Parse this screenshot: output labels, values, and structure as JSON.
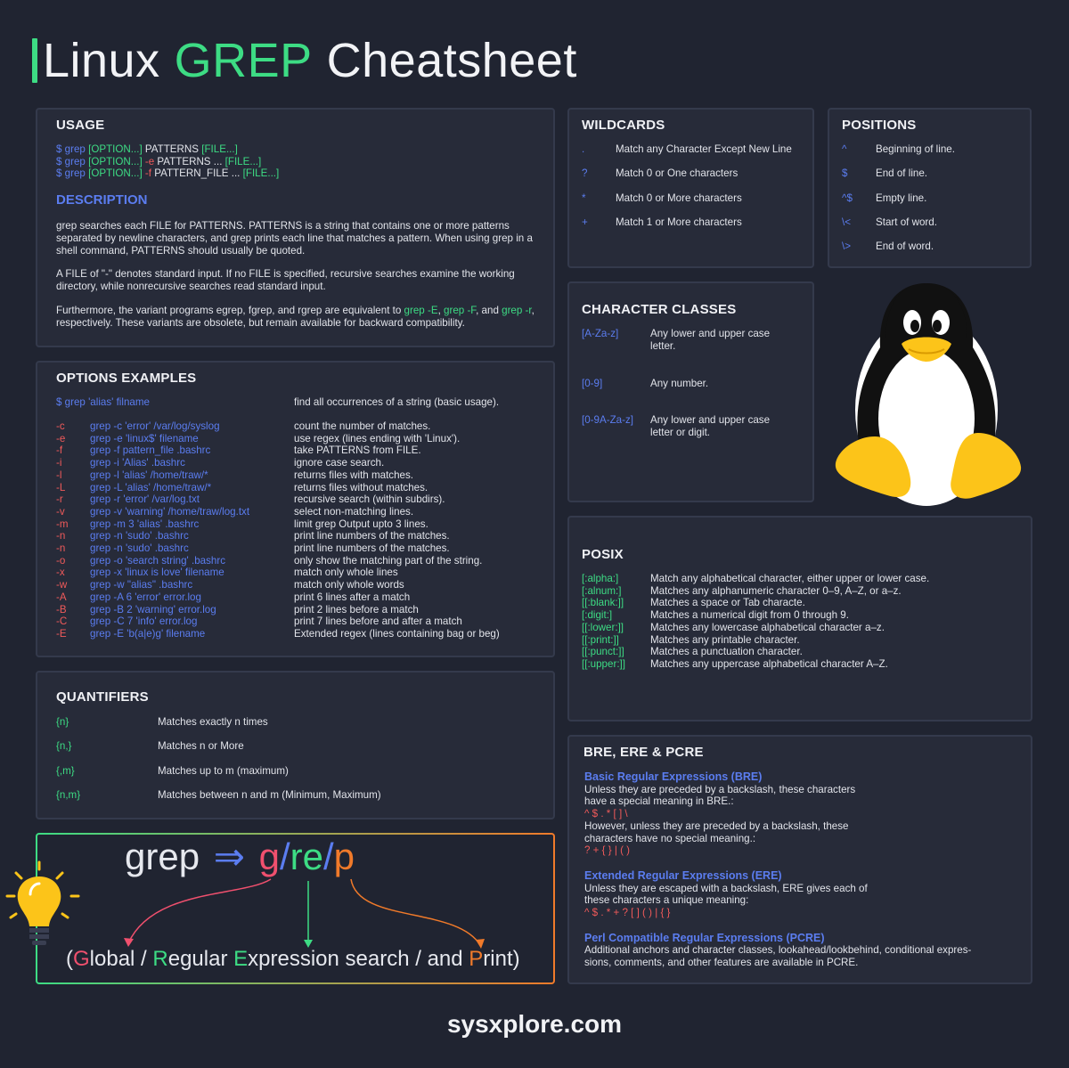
{
  "title": {
    "prefix": "Linux",
    "highlight": "GREP",
    "suffix": "Cheatsheet"
  },
  "usage": {
    "heading": "USAGE",
    "lines": [
      {
        "cmd": "$ grep",
        "opt": "[OPTION...]",
        "flag": "",
        "rest": " PATTERNS ",
        "file": "[FILE...]"
      },
      {
        "cmd": "$ grep",
        "opt": "[OPTION...]",
        "flag": " -e",
        "rest": " PATTERNS ... ",
        "file": "[FILE...]"
      },
      {
        "cmd": "$ grep",
        "opt": "[OPTION...]",
        "flag": " -f",
        "rest": " PATTERN_FILE ... ",
        "file": "[FILE...]"
      }
    ],
    "description_heading": "DESCRIPTION",
    "p1": "grep searches each FILE for PATTERNS. PATTERNS is a string that contains one or more patterns separated by newline characters, and grep prints each line that matches a pattern. When using grep in a shell command, PATTERNS should usually be quoted.",
    "p2": "A FILE of \"-\" denotes standard input. If no FILE is specified, recursive searches examine the working directory, while nonrecursive searches read standard input.",
    "p3a": "Furthermore, the variant programs egrep, fgrep, and rgrep are equivalent to ",
    "p3b": "grep -E",
    "p3c": ", ",
    "p3d": "grep -F",
    "p3e": ", and ",
    "p3f": "grep -r",
    "p3g": ", respectively. These variants are obsolete, but remain available for backward compatibility."
  },
  "options": {
    "heading": "OPTIONS EXAMPLES",
    "basic_cmd": "$ grep 'alias' filname",
    "basic_desc": "find all occurrences of a string (basic usage).",
    "rows": [
      {
        "flag": "-c",
        "cmd": "grep -c 'error' /var/log/syslog",
        "desc": "count the number of matches."
      },
      {
        "flag": "-e",
        "cmd": "grep -e 'linux$' filename",
        "desc": "use regex (lines ending with 'Linux')."
      },
      {
        "flag": "-f",
        "cmd": "grep -f pattern_file .bashrc",
        "desc": "take PATTERNS from FILE."
      },
      {
        "flag": "-i",
        "cmd": "grep -i 'Alias' .bashrc",
        "desc": "ignore case search."
      },
      {
        "flag": "-l",
        "cmd": "grep -l 'alias' /home/traw/*",
        "desc": "returns files with matches."
      },
      {
        "flag": "-L",
        "cmd": "grep -L 'alias' /home/traw/*",
        "desc": "returns files without matches."
      },
      {
        "flag": "-r",
        "cmd": "grep -r 'error' /var/log.txt",
        "desc": "recursive search (within subdirs)."
      },
      {
        "flag": "-v",
        "cmd": "grep -v 'warning' /home/traw/log.txt",
        "desc": "select non-matching lines."
      },
      {
        "flag": "-m",
        "cmd": "grep -m 3 'alias' .bashrc",
        "desc": "limit grep Output upto 3 lines."
      },
      {
        "flag": "-n",
        "cmd": "grep -n 'sudo' .bashrc",
        "desc": "print line numbers of the matches."
      },
      {
        "flag": "-n",
        "cmd": "grep -n 'sudo' .bashrc",
        "desc": "print line numbers of the matches."
      },
      {
        "flag": "-o",
        "cmd": "grep -o 'search string' .bashrc",
        "desc": "only show the matching part of the string."
      },
      {
        "flag": "-x",
        "cmd": "grep -x 'linux is love' filename",
        "desc": "match only whole lines"
      },
      {
        "flag": "-w",
        "cmd": "grep -w \"alias\" .bashrc",
        "desc": "match only whole words"
      },
      {
        "flag": "-A",
        "cmd": "grep -A 6 'error' error.log",
        "desc": "print 6 lines after a match"
      },
      {
        "flag": "-B",
        "cmd": "grep -B 2 'warning' error.log",
        "desc": "print 2 lines before a match"
      },
      {
        "flag": "-C",
        "cmd": "grep -C 7 'info' error.log",
        "desc": "print 7 lines before and after a match"
      },
      {
        "flag": "-E",
        "cmd": "grep -E 'b(a|e)g' filename",
        "desc": "Extended regex (lines containing bag or beg)"
      }
    ]
  },
  "quantifiers": {
    "heading": "QUANTIFIERS",
    "rows": [
      {
        "sym": "{n}",
        "desc": "Matches exactly n times"
      },
      {
        "sym": "{n,}",
        "desc": "Matches n or More"
      },
      {
        "sym": "{,m}",
        "desc": "Matches up to m (maximum)"
      },
      {
        "sym": "{n,m}",
        "desc": "Matches between n and m (Minimum, Maximum)"
      }
    ]
  },
  "wildcards": {
    "heading": "WILDCARDS",
    "rows": [
      {
        "sym": ".",
        "desc": "Match any Character Except New Line"
      },
      {
        "sym": "?",
        "desc": "Match 0 or One characters"
      },
      {
        "sym": "*",
        "desc": "Match 0 or More characters"
      },
      {
        "sym": "+",
        "desc": "Match 1 or More characters"
      }
    ]
  },
  "positions": {
    "heading": "POSITIONS",
    "rows": [
      {
        "sym": "^",
        "desc": "Beginning of line."
      },
      {
        "sym": "$",
        "desc": "End of line."
      },
      {
        "sym": "^$",
        "desc": "Empty line."
      },
      {
        "sym": "\\<",
        "desc": "Start of word."
      },
      {
        "sym": "\\>",
        "desc": "End of word."
      }
    ]
  },
  "char_classes": {
    "heading": "CHARACTER CLASSES",
    "rows": [
      {
        "sym": "[A-Za-z]",
        "desc1": "Any lower and upper case",
        "desc2": " letter."
      },
      {
        "sym": "[0-9]",
        "desc1": "Any number.",
        "desc2": ""
      },
      {
        "sym": "[0-9A-Za-z]",
        "desc1": "Any lower and upper case",
        "desc2": "letter or digit."
      }
    ]
  },
  "posix": {
    "heading": "POSIX",
    "rows": [
      {
        "sym": "[:alpha:]",
        "desc": "Match any alphabetical character, either upper or lower case."
      },
      {
        "sym": "[:alnum:]",
        "desc": "Matches any alphanumeric character 0–9, A–Z, or a–z."
      },
      {
        "sym": "[[:blank:]]",
        "desc": "Matches a space or Tab characte."
      },
      {
        "sym": "[:digit:]",
        "desc": "Matches a numerical digit from 0 through 9."
      },
      {
        "sym": "[[:lower:]]",
        "desc": "Matches any lowercase alphabetical character a–z."
      },
      {
        "sym": "[[:print:]]",
        "desc": "Matches any printable character."
      },
      {
        "sym": "[[:punct:]]",
        "desc": "Matches a punctuation character."
      },
      {
        "sym": "[[:upper:]]",
        "desc": "Matches any uppercase alphabetical character A–Z."
      }
    ]
  },
  "regex": {
    "heading": "BRE, ERE & PCRE",
    "bre_title": "Basic Regular Expressions (BRE)",
    "bre_l1": "Unless they are preceded by a backslash, these characters",
    "bre_l2": "have a special meaning in BRE.:",
    "bre_chars1": "^ $ . * [ ] \\",
    "bre_l3": "However, unless they are preceded by a backslash, these",
    "bre_l4": "characters have no special meaning.:",
    "bre_chars2": "? + { } | ( )",
    "ere_title": "Extended Regular Expressions (ERE)",
    "ere_l1": "Unless they are escaped with a backslash, ERE gives each of",
    "ere_l2": "these characters a unique meaning:",
    "ere_chars": "^ $ . * + ? [ ] ( ) | { }",
    "pcre_title": "Perl Compatible Regular Expressions (PCRE)",
    "pcre_l1": "Additional anchors and character classes, lookahead/lookbehind, conditional expres-",
    "pcre_l2": "sions, comments, and other features are available in PCRE."
  },
  "mnemonic": {
    "grep": "grep",
    "arrow": "⇒",
    "g": "g",
    "slash": "/",
    "re": "re",
    "p": "p",
    "open": "(",
    "G": "G",
    "lobal": "lobal / ",
    "R": "R",
    "egular": "egular ",
    "E": "E",
    "xpression": "xpression search / and ",
    "P": "P",
    "rint": "rint)"
  },
  "footer": "sysxplore.com",
  "colors": {
    "bg": "#202431",
    "panel": "#272b39",
    "green": "#3ddc84",
    "blue": "#5b7df0",
    "red": "#f05a5a",
    "orange": "#f07a2a",
    "pink": "#f0506e",
    "yellow": "#fcc419"
  },
  "icons": [
    "tux-penguin-icon",
    "lightbulb-icon"
  ]
}
